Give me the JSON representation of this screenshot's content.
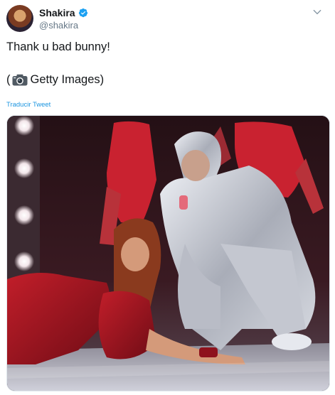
{
  "tweet": {
    "author_name": "Shakira",
    "author_handle": "@shakira",
    "text_line1": "Thank u bad bunny!",
    "text_line2_open": "(",
    "text_line2_rest": " Getty Images)",
    "translate_label": "Traducir Tweet"
  },
  "icons": {
    "verified": "verified-badge-icon",
    "menu": "chevron-down-icon",
    "camera": "camera-icon"
  },
  "colors": {
    "link": "#1b95e0",
    "verified": "#1da1f2",
    "secondary_text": "#657786"
  }
}
